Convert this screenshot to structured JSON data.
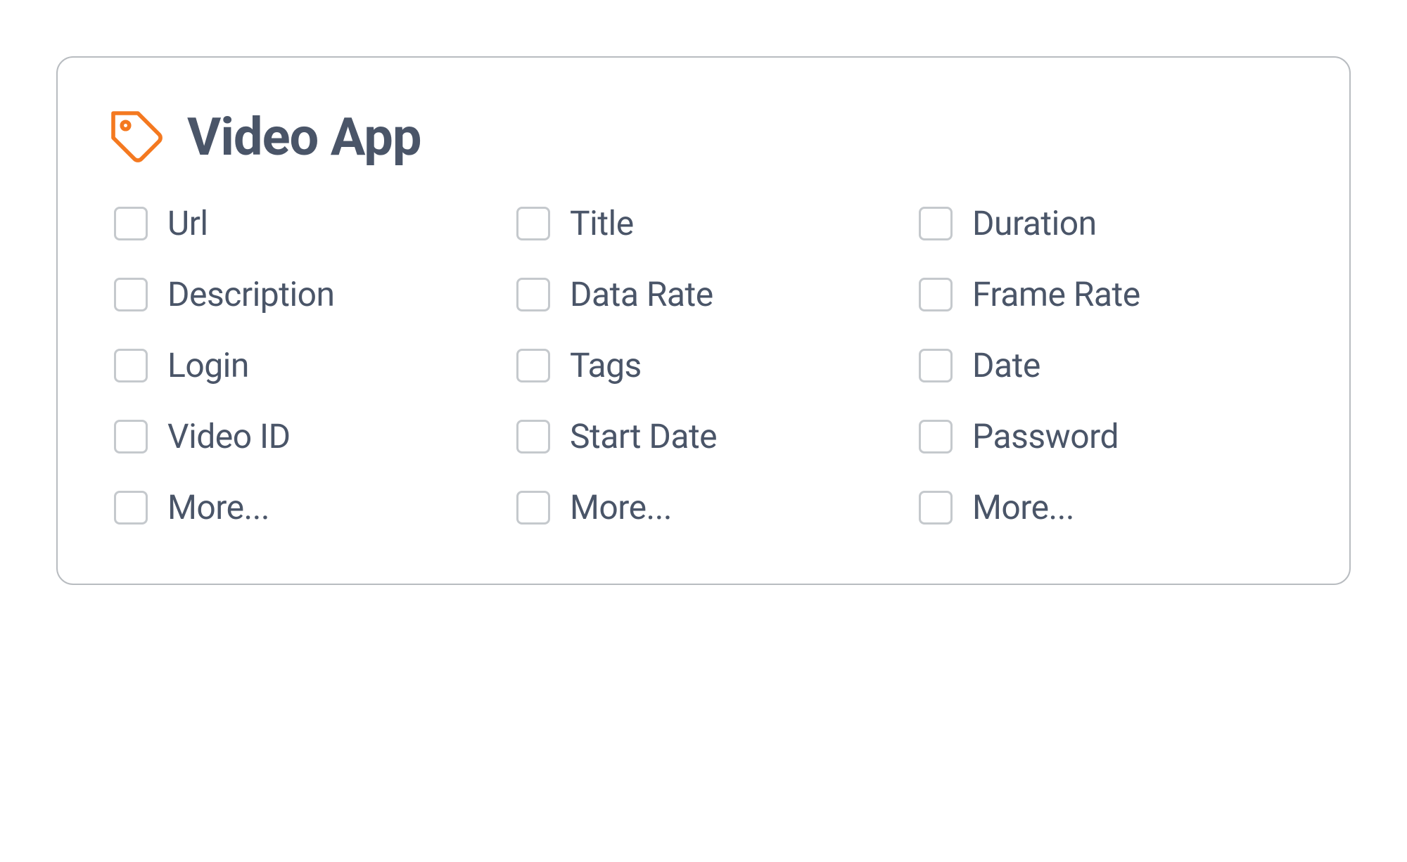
{
  "card": {
    "title": "Video App",
    "columns": [
      [
        "Url",
        "Description",
        "Login",
        "Video ID",
        "More..."
      ],
      [
        "Title",
        "Data Rate",
        "Tags",
        "Start Date",
        "More..."
      ],
      [
        "Duration",
        "Frame Rate",
        "Date",
        "Password",
        "More..."
      ]
    ]
  }
}
